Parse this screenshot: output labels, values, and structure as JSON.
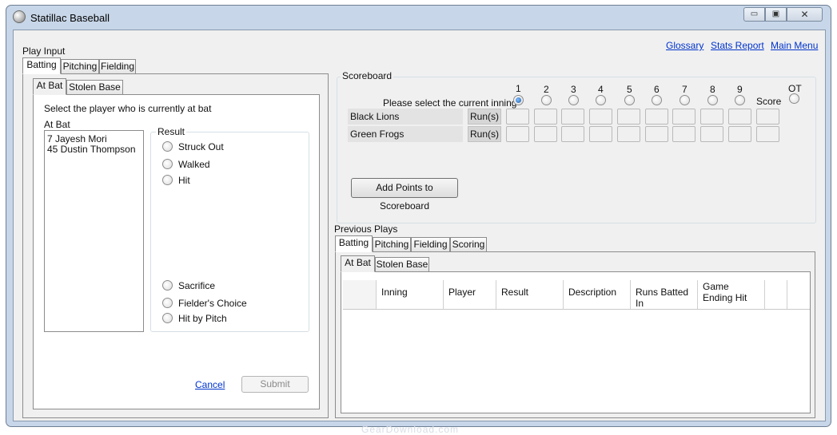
{
  "window": {
    "title": "Statillac Baseball",
    "min_glyph": "▭",
    "max_glyph": "▣",
    "close_glyph": "✕"
  },
  "links": {
    "glossary": "Glossary",
    "stats_report": "Stats Report",
    "main_menu": "Main Menu"
  },
  "play_input": {
    "label": "Play Input",
    "tabs": [
      "Batting",
      "Pitching",
      "Fielding"
    ],
    "sub_tabs": [
      "At Bat",
      "Stolen Base"
    ],
    "instruction": "Select the player who is currently at bat",
    "at_bat_label": "At Bat",
    "players": [
      "7 Jayesh Mori",
      "45 Dustin Thompson"
    ],
    "result_label": "Result",
    "results": [
      "Struck Out",
      "Walked",
      "Hit",
      "Sacrifice",
      "Fielder's Choice",
      "Hit by Pitch"
    ],
    "cancel": "Cancel",
    "submit": "Submit"
  },
  "scoreboard": {
    "label": "Scoreboard",
    "prompt": "Please select the current inning",
    "innings": [
      "1",
      "2",
      "3",
      "4",
      "5",
      "6",
      "7",
      "8",
      "9"
    ],
    "score_label": "Score",
    "ot_label": "OT",
    "selected_inning": "1",
    "teams": [
      {
        "name": "Black Lions",
        "runs_label": "Run(s)"
      },
      {
        "name": "Green Frogs",
        "runs_label": "Run(s)"
      }
    ],
    "add_button": "Add Points to Scoreboard"
  },
  "previous_plays": {
    "label": "Previous Plays",
    "tabs": [
      "Batting",
      "Pitching",
      "Fielding",
      "Scoring"
    ],
    "sub_tabs": [
      "At Bat",
      "Stolen Base"
    ],
    "columns": [
      "Inning",
      "Player",
      "Result",
      "Description",
      "Runs Batted In",
      "Game Ending Hit"
    ]
  },
  "watermark": "GearDownload.com"
}
